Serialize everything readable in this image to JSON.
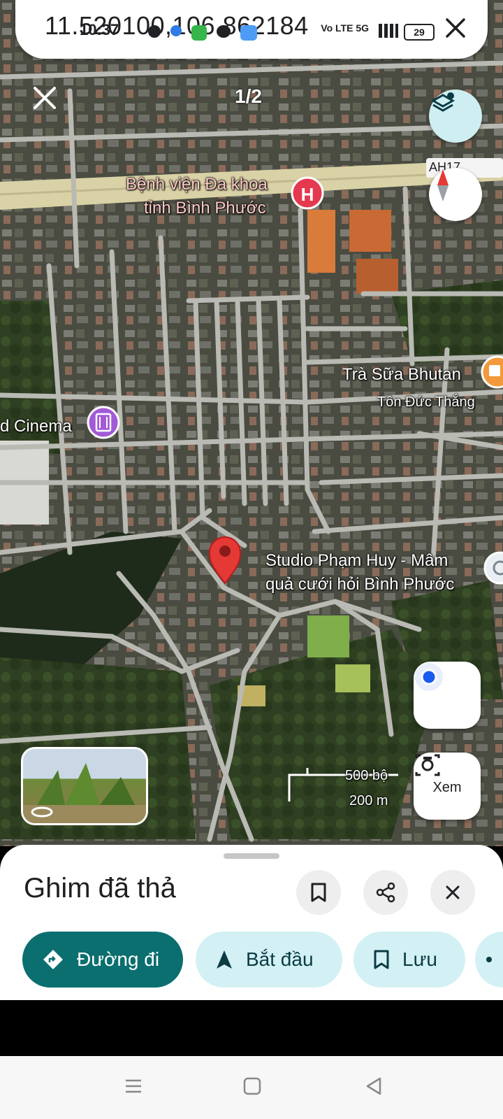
{
  "status_bar": {
    "time": "10:37",
    "network": "Vo LTE 5G",
    "battery": "29"
  },
  "search": {
    "coordinates": "11.520100,106.862184",
    "close_icon": "close-icon"
  },
  "photo_counter": "1/2",
  "map": {
    "labels": {
      "hospital": "Bệnh viện Đa khoa tỉnh Bình Phước",
      "hospital_line1": "Bệnh viện Đa khoa",
      "hospital_line2": "tỉnh Bình Phước",
      "road_code": "AH17",
      "tea": "Trà Sữa Bhutan",
      "street": "Tôn Đức Thắng",
      "cinema": "d Cinema",
      "studio_line1": "Studio Phạm Huy - Mâm",
      "studio_line2": "quả cưới hỏi Bình Phước"
    },
    "scale": {
      "imperial": "500 bộ",
      "metric": "200 m"
    },
    "buttons": {
      "layers_icon": "layers-icon",
      "compass_icon": "compass-icon",
      "location_icon": "my-location-icon",
      "view_label": "Xem"
    },
    "colors": {
      "pin": "#e53935",
      "primary": "#0b6e6f",
      "secondary": "#d3f1f4"
    }
  },
  "sheet": {
    "title": "Ghim đã thả",
    "actions": {
      "directions": "Đường đi",
      "start": "Bắt đầu",
      "save": "Lưu"
    }
  }
}
